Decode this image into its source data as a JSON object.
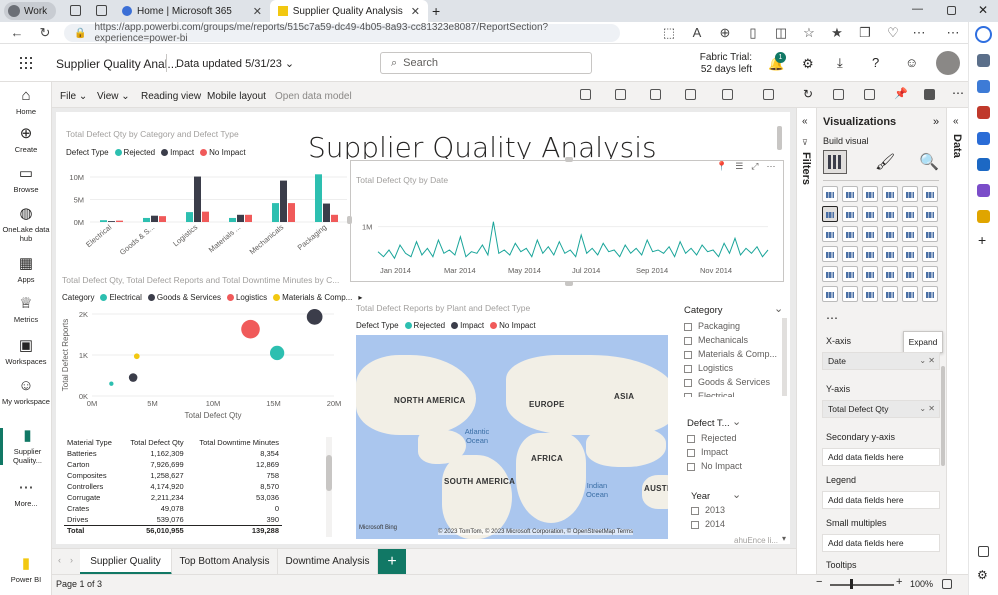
{
  "browser": {
    "profile": "Work",
    "tabs": [
      {
        "label": "Home | Microsoft 365"
      },
      {
        "label": "Supplier Quality Analysis - Power"
      }
    ],
    "url": "https://app.powerbi.com/groups/me/reports/515c7a59-dc49-4b05-8a93-cc81323e8087/ReportSection?experience=power-bi"
  },
  "header": {
    "report_name": "Supplier Quality Anal...",
    "updated": "Data updated 5/31/23",
    "search_placeholder": "Search",
    "trial_line1": "Fabric Trial:",
    "trial_line2": "52 days left",
    "notif_count": "1"
  },
  "leftnav": [
    {
      "label": "Home",
      "icon": "home-icon"
    },
    {
      "label": "Create",
      "icon": "plus-circle-icon"
    },
    {
      "label": "Browse",
      "icon": "folder-icon"
    },
    {
      "label": "OneLake data hub",
      "icon": "onelake-icon"
    },
    {
      "label": "Apps",
      "icon": "apps-icon"
    },
    {
      "label": "Metrics",
      "icon": "trophy-icon"
    },
    {
      "label": "Workspaces",
      "icon": "workspaces-icon"
    },
    {
      "label": "My workspace",
      "icon": "person-icon"
    },
    {
      "label": "Supplier Quality...",
      "icon": "report-icon"
    },
    {
      "label": "More...",
      "icon": "more-icon"
    },
    {
      "label": "Power BI",
      "icon": "powerbi-logo"
    }
  ],
  "ribbon": {
    "file": "File",
    "view": "View",
    "reading": "Reading view",
    "mobile": "Mobile layout",
    "open_model": "Open data model"
  },
  "report": {
    "title": "Supplier Quality Analysis",
    "bar_chart": {
      "title": "Total Defect Qty by Category and Defect Type",
      "legend_label": "Defect Type",
      "legend": [
        "Rejected",
        "Impact",
        "No Impact"
      ],
      "colors": [
        "#2dbfb0",
        "#3b3d4a",
        "#f05a5a"
      ]
    },
    "line_chart": {
      "title": "Total Defect Qty by Date",
      "ytick": "1M"
    },
    "scatter": {
      "title": "Total Defect Qty, Total Defect Reports and Total Downtime Minutes by C...",
      "legend_label": "Category",
      "legend": [
        "Electrical",
        "Goods & Services",
        "Logistics",
        "Materials & Comp..."
      ],
      "ylabel": "Total Defect Reports",
      "xlabel": "Total Defect Qty"
    },
    "map": {
      "title": "Total Defect Reports by Plant and Defect Type",
      "legend_label": "Defect Type",
      "legend": [
        "Rejected",
        "Impact",
        "No Impact"
      ],
      "regions": [
        "NORTH AMERICA",
        "EUROPE",
        "ASIA",
        "AFRICA",
        "SOUTH AMERICA",
        "AUSTR"
      ],
      "oceans": [
        "Atlantic Ocean",
        "Indian Ocean"
      ],
      "credit": "© 2023 TomTom, © 2023 Microsoft Corporation, © OpenStreetMap Terms",
      "bing": "Microsoft Bing"
    },
    "table": {
      "headers": [
        "Material Type",
        "Total Defect Qty",
        "Total Downtime Minutes"
      ],
      "rows": [
        [
          "Batteries",
          "1,162,309",
          "8,354"
        ],
        [
          "Carton",
          "7,926,699",
          "12,869"
        ],
        [
          "Composites",
          "1,258,627",
          "758"
        ],
        [
          "Controllers",
          "4,174,920",
          "8,570"
        ],
        [
          "Corrugate",
          "2,211,234",
          "53,036"
        ],
        [
          "Crates",
          "49,078",
          "0"
        ],
        [
          "Drives",
          "539,076",
          "390"
        ]
      ],
      "total": [
        "Total",
        "56,010,955",
        "139,288"
      ]
    },
    "slicer_category": {
      "title": "Category",
      "items": [
        "Packaging",
        "Mechanicals",
        "Materials & Comp...",
        "Logistics",
        "Goods & Services",
        "Electrical"
      ]
    },
    "slicer_defect": {
      "title": "Defect T...",
      "items": [
        "Rejected",
        "Impact",
        "No Impact"
      ]
    },
    "slicer_year": {
      "title": "Year",
      "items": [
        "2013",
        "2014"
      ]
    },
    "slicer_cut": "ahuEnce li..."
  },
  "chart_data": [
    {
      "type": "bar",
      "title": "Total Defect Qty by Category and Defect Type",
      "categories": [
        "Electrical",
        "Goods & S...",
        "Logistics",
        "Materials ...",
        "Mechanicals",
        "Packaging"
      ],
      "series": [
        {
          "name": "Rejected",
          "values": [
            0.4,
            0.9,
            2.2,
            0.9,
            4.2,
            10.6
          ]
        },
        {
          "name": "Impact",
          "values": [
            0.2,
            1.4,
            10.1,
            1.6,
            9.2,
            4.1
          ]
        },
        {
          "name": "No Impact",
          "values": [
            0.3,
            1.3,
            2.3,
            1.6,
            4.2,
            1.6
          ]
        }
      ],
      "ylabel": "",
      "xlabel": "",
      "yticks": [
        "0M",
        "5M",
        "10M"
      ],
      "ylim": [
        0,
        12
      ]
    },
    {
      "type": "line",
      "title": "Total Defect Qty by Date",
      "xlabels": [
        "Jan 2014",
        "Mar 2014",
        "May 2014",
        "Jul 2014",
        "Sep 2014",
        "Nov 2014"
      ],
      "values": [
        0.25,
        0.1,
        0.3,
        0.05,
        0.45,
        0.2,
        0.1,
        0.55,
        0.15,
        0.35,
        0.1,
        0.6,
        0.2,
        0.3,
        0.15,
        0.7,
        0.1,
        0.25,
        0.2,
        0.45,
        0.15,
        1.15,
        0.2,
        0.3,
        0.15,
        0.5,
        0.25,
        0.35,
        0.1,
        0.6,
        0.2,
        0.4,
        0.15,
        0.55,
        0.2,
        0.3,
        0.1,
        0.75,
        0.2,
        0.35,
        0.15,
        0.5,
        0.25,
        0.3,
        0.1,
        0.45,
        0.2,
        0.35,
        0.15,
        0.6,
        0.25,
        0.3,
        0.2,
        0.4,
        0.1,
        0.55,
        0.2,
        0.35,
        0.15,
        0.45,
        0.25,
        0.3,
        0.1,
        0.5,
        0.2,
        0.65,
        0.15,
        0.35,
        0.2,
        0.4,
        0.1,
        0.3
      ],
      "ylim": [
        0,
        1.5
      ]
    },
    {
      "type": "scatter",
      "title": "Total Defect Qty, Total Defect Reports and Total Downtime Minutes by C...",
      "xticks": [
        "0M",
        "5M",
        "10M",
        "15M",
        "20M"
      ],
      "yticks": [
        "0K",
        "1K",
        "2K"
      ],
      "xlim": [
        0,
        20
      ],
      "ylim": [
        0,
        2
      ],
      "points": [
        {
          "series": "Electrical",
          "x": 1.6,
          "y": 0.3,
          "size": 3
        },
        {
          "series": "Goods & Services",
          "x": 3.4,
          "y": 0.45,
          "size": 6
        },
        {
          "series": "Materials & Comp...",
          "x": 3.7,
          "y": 0.97,
          "size": 4
        },
        {
          "series": "Logistics",
          "x": 13.1,
          "y": 1.63,
          "size": 13
        },
        {
          "series": "Electrical",
          "x": 15.3,
          "y": 1.05,
          "size": 10
        },
        {
          "series": "Goods & Services",
          "x": 18.4,
          "y": 1.93,
          "size": 11
        }
      ],
      "xlabel": "Total Defect Qty",
      "ylabel": "Total Defect Reports"
    }
  ],
  "pages": [
    "Supplier Quality",
    "Top Bottom Analysis",
    "Downtime Analysis"
  ],
  "status": {
    "page": "Page 1 of 3",
    "zoom": "100%"
  },
  "filters_label": "Filters",
  "viz": {
    "title": "Visualizations",
    "build": "Build visual",
    "expand": "Expand",
    "wells": [
      {
        "name": "X-axis",
        "value": "Date",
        "filled": true
      },
      {
        "name": "Y-axis",
        "value": "Total Defect Qty",
        "filled": true
      },
      {
        "name": "Secondary y-axis",
        "value": "Add data fields here",
        "filled": false
      },
      {
        "name": "Legend",
        "value": "Add data fields here",
        "filled": false
      },
      {
        "name": "Small multiples",
        "value": "Add data fields here",
        "filled": false
      },
      {
        "name": "Tooltips",
        "value": "",
        "filled": false
      }
    ]
  },
  "data_label": "Data"
}
